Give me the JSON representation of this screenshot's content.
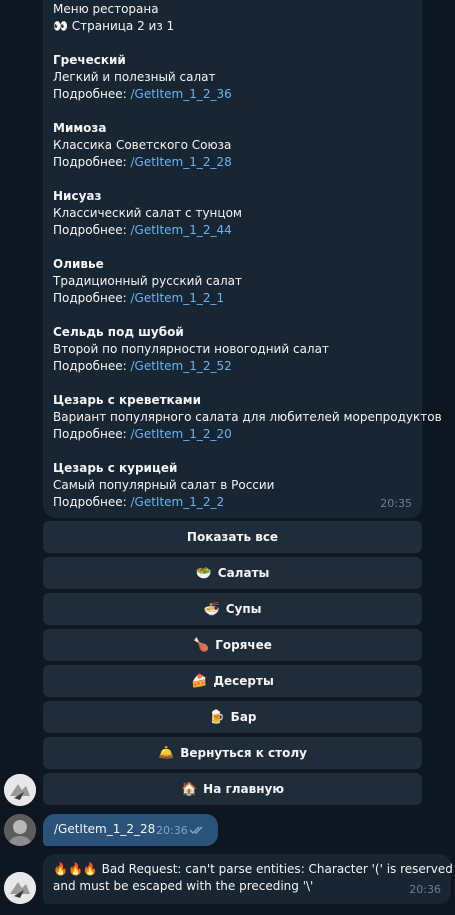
{
  "menu_message": {
    "title": "Меню ресторана",
    "page_line": "👀 Страница 2 из 1",
    "link_prefix": "Подробнее: ",
    "items": [
      {
        "name": "Греческий",
        "desc": "Легкий и полезный салат",
        "link": "/GetItem_1_2_36"
      },
      {
        "name": "Мимоза",
        "desc": "Классика Советского Союза",
        "link": "/GetItem_1_2_28"
      },
      {
        "name": "Нисуаз",
        "desc": "Классический салат с тунцом",
        "link": "/GetItem_1_2_44"
      },
      {
        "name": "Оливье",
        "desc": "Традиционный русский салат",
        "link": "/GetItem_1_2_1"
      },
      {
        "name": "Сельдь под шубой",
        "desc": "Второй по популярности новогодний салат",
        "link": "/GetItem_1_2_52"
      },
      {
        "name": "Цезарь с креветками",
        "desc": "Вариант популярного салата для любителей морепродуктов",
        "link": "/GetItem_1_2_20"
      },
      {
        "name": "Цезарь с курицей",
        "desc": "Самый популярный салат в России",
        "link": "/GetItem_1_2_2"
      }
    ],
    "time": "20:35"
  },
  "keyboard": [
    {
      "emoji": "",
      "label": "Показать все"
    },
    {
      "emoji": "🥗",
      "label": "Салаты"
    },
    {
      "emoji": "🍜",
      "label": "Супы"
    },
    {
      "emoji": "🍗",
      "label": "Горячее"
    },
    {
      "emoji": "🍰",
      "label": "Десерты"
    },
    {
      "emoji": "🍺",
      "label": "Бар"
    },
    {
      "emoji": "🛎️",
      "label": "Вернуться к столу"
    },
    {
      "emoji": "🏠",
      "label": "На главную"
    }
  ],
  "outgoing": {
    "text": "/GetItem_1_2_28",
    "time": "20:36",
    "status_icon": "double-check-icon"
  },
  "error_message": {
    "line1": "🔥🔥🔥 Bad Request: can't parse entities: Character '(' is reserved",
    "line2": "and must be escaped with the preceding '\\'",
    "time": "20:36"
  },
  "colors": {
    "background": "#0e1621",
    "bubble": "#182533",
    "outgoing_bubble": "#2b5278",
    "link": "#6ab3f3",
    "keyboard_button": "#1f2c3a"
  }
}
